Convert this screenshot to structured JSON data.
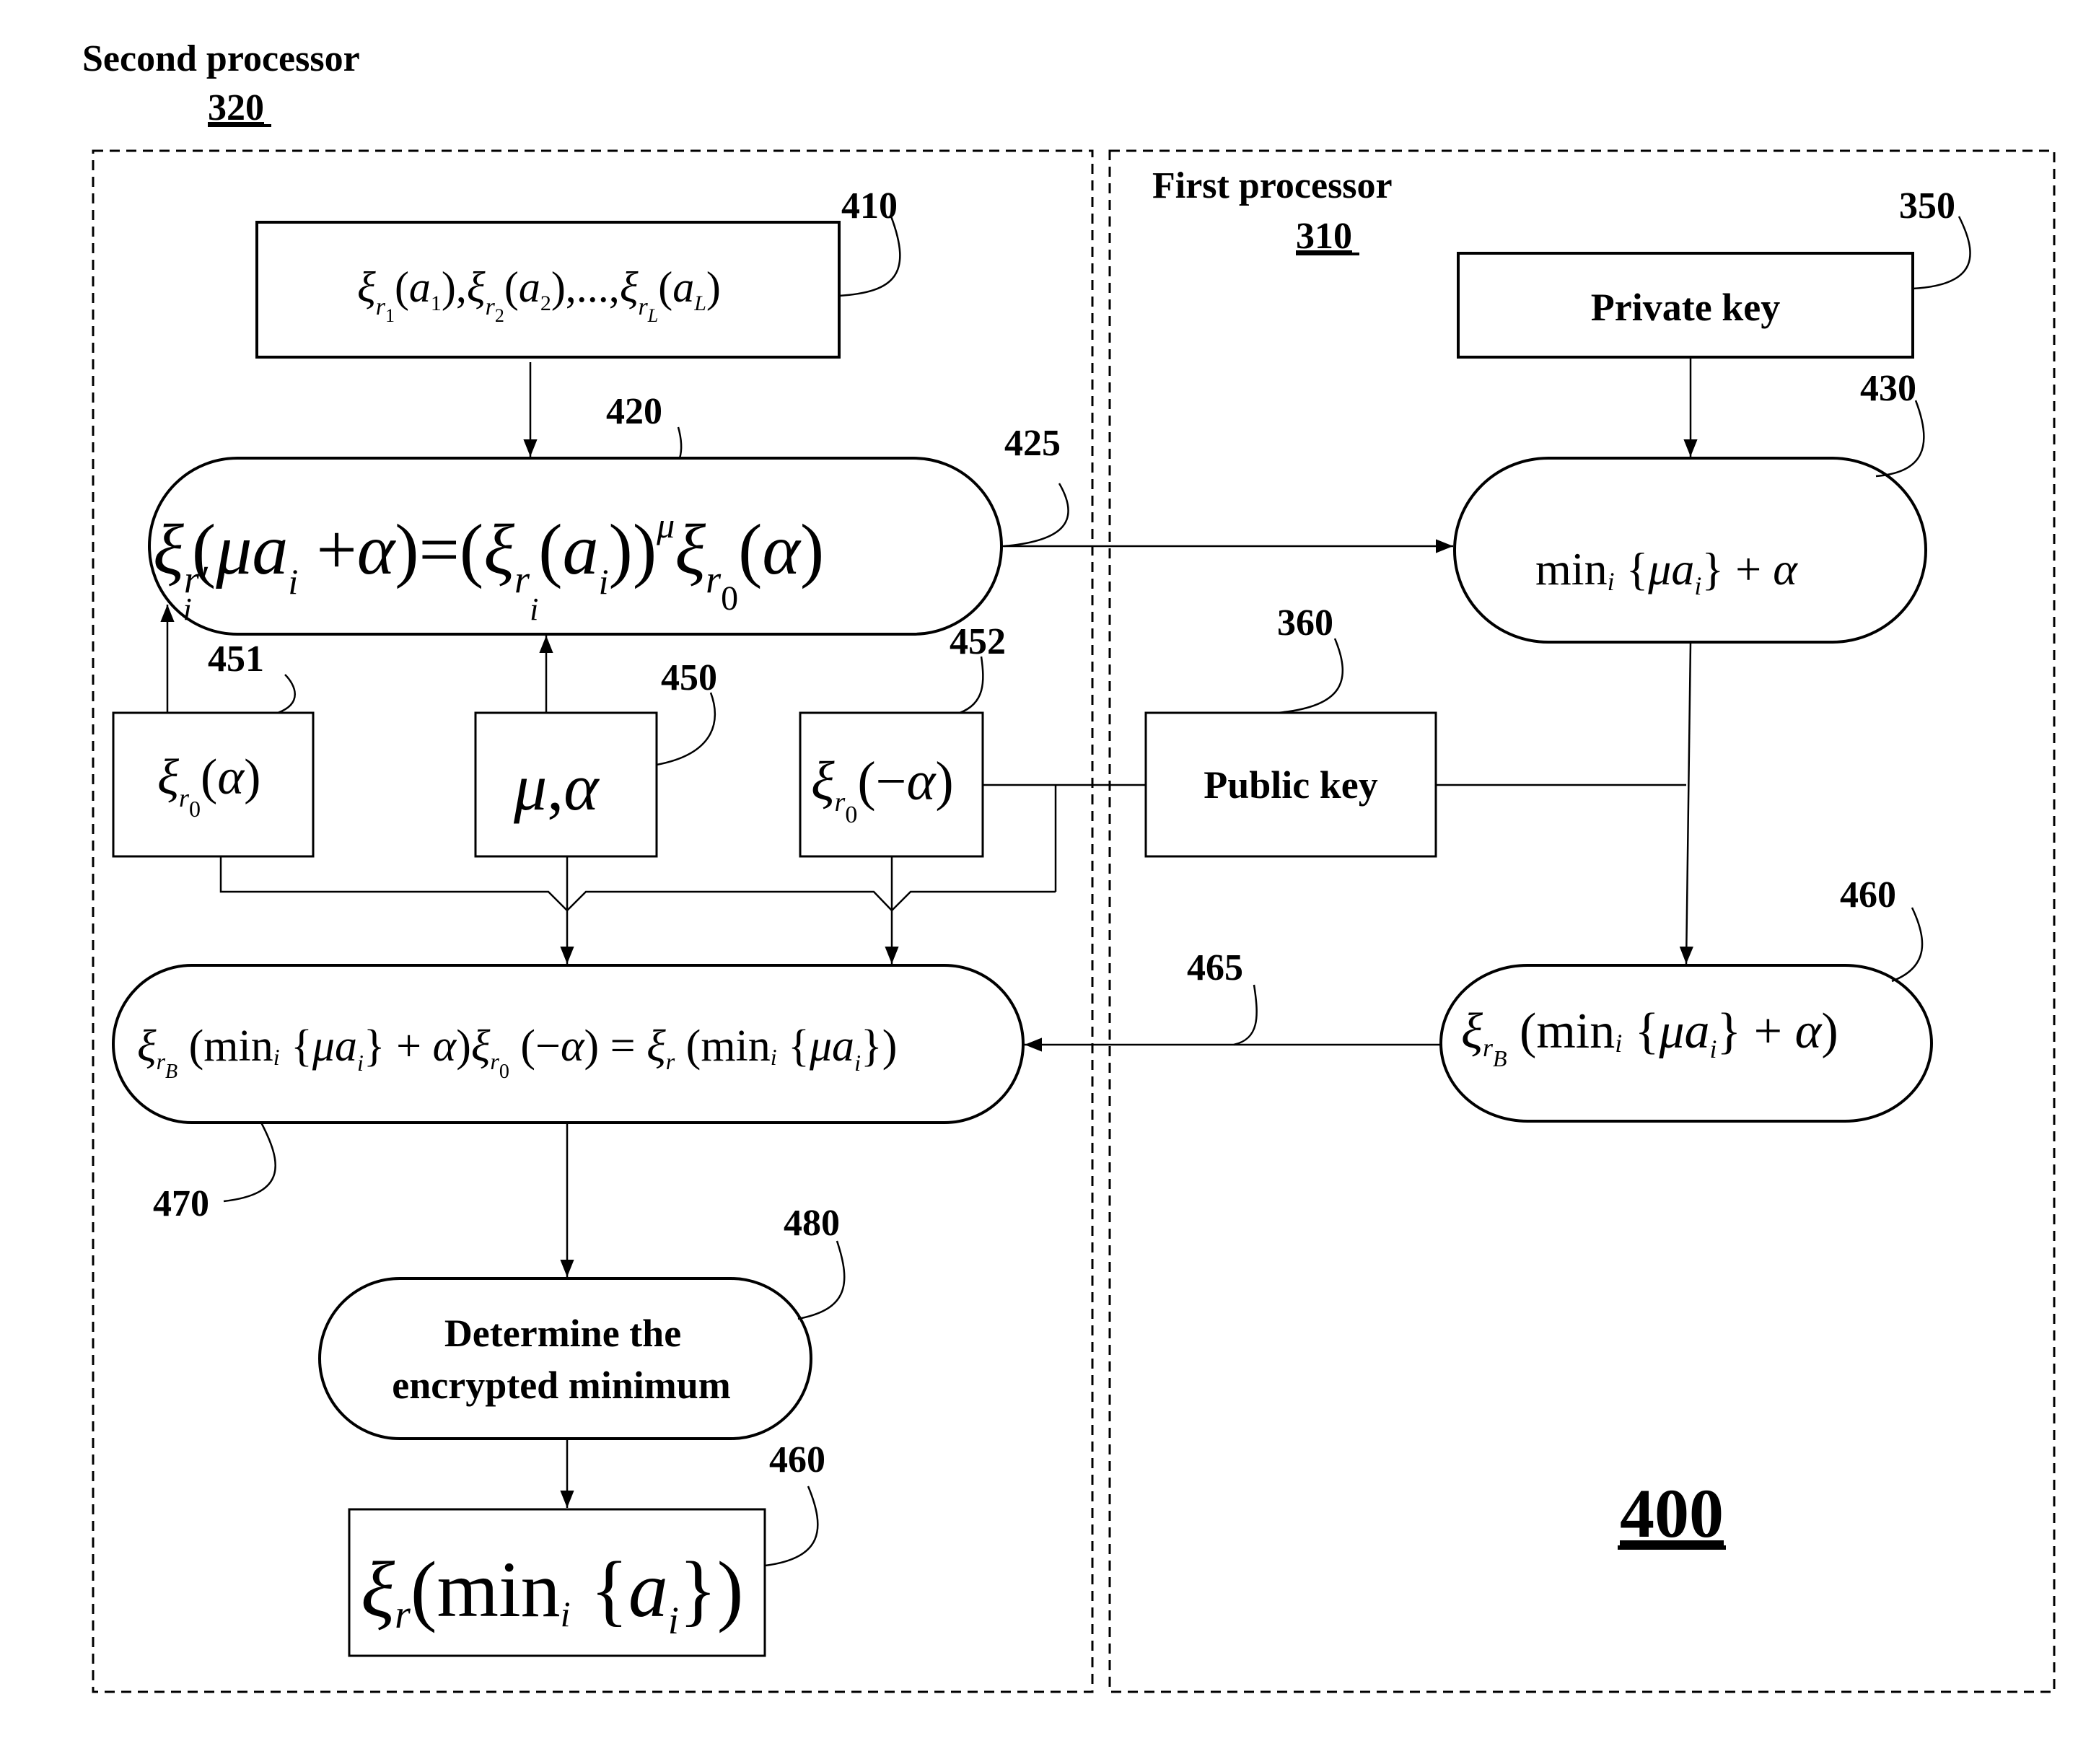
{
  "figure": {
    "number": "400",
    "second_processor": {
      "title": "Second processor",
      "ref": "320"
    },
    "first_processor": {
      "title": "First processor",
      "ref": "310"
    }
  },
  "nodes": {
    "encrypted_inputs": {
      "ref": "410",
      "text": "ξr1(a1), ξr2(a2),..., ξrL(aL)"
    },
    "masked_values": {
      "ref": "420",
      "text": "ξr'i(μai + α) = (ξri(ai))^μ ξr0(α)"
    },
    "transfer_to_first": {
      "ref": "425"
    },
    "private_key": {
      "ref": "350",
      "text": "Private key"
    },
    "decrypted_min": {
      "ref": "430",
      "text": "mini{μai} + α"
    },
    "public_key": {
      "ref": "360",
      "text": "Public key"
    },
    "enc_alpha": {
      "ref": "451",
      "text": "ξr0(α)"
    },
    "mu_alpha": {
      "ref": "450",
      "text": "μ, α"
    },
    "enc_neg_alpha": {
      "ref": "452",
      "text": "ξr0(−α)"
    },
    "reencrypted_min": {
      "ref": "460",
      "text": "ξrB(mini{μai} + α)"
    },
    "transfer_to_second": {
      "ref": "465"
    },
    "unmask": {
      "ref": "470",
      "text": "ξrB(mini{μai} + α)ξr0(−α) = ξr(mini{μai})"
    },
    "determine": {
      "ref": "480",
      "line1": "Determine the",
      "line2": "encrypted minimum"
    },
    "result": {
      "ref": "460",
      "text": "ξr(mini{ai})"
    }
  },
  "glyphs": {
    "xi": "ξ",
    "mu": "μ",
    "alpha": "α",
    "minus": "−",
    "min": "min",
    "ellipsis": "...,"
  }
}
